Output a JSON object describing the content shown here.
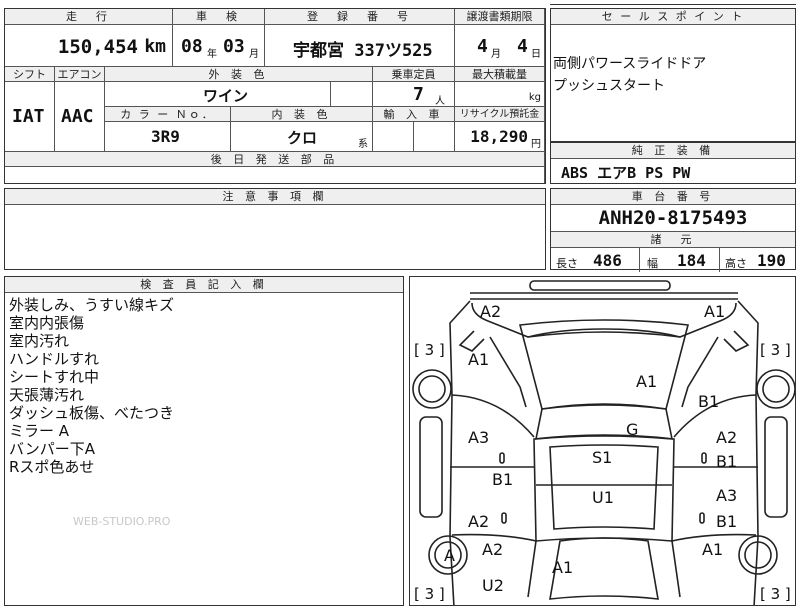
{
  "headers": {
    "mileage": "走　行",
    "inspection": "車　検",
    "registration": "登　録　番　号",
    "transfer_deadline": "譲渡書類期限",
    "sales_point": "セ ー ル ス ポ イ ン ト",
    "shift": "シフト",
    "aircon": "エアコン",
    "exterior_color": "外 装 色",
    "capacity": "乗車定員",
    "max_load": "最大積載量",
    "color_no": "カ ラ ー Ｎｏ．",
    "interior_color": "内 装 色",
    "import": "輸 入 車",
    "recycle": "リサイクル預託金",
    "later_parts": "後 日 発 送 部 品",
    "standard_equipment": "純 正 装 備",
    "notes": "注 意 事 項 欄",
    "chassis": "車 台 番 号",
    "specs": "諸　元",
    "inspector_notes": "検 査 員 記 入 欄"
  },
  "vehicle": {
    "mileage": "150,454",
    "mileage_unit": "km",
    "inspection_year": "08",
    "year_unit": "年",
    "inspection_month": "03",
    "month_unit": "月",
    "plate": "宇都宮 337ツ525",
    "deadline_month": "4",
    "deadline_month_unit": "月",
    "deadline_day": "4",
    "deadline_day_unit": "日",
    "shift": "IAT",
    "aircon": "AAC",
    "exterior_color": "ワイン",
    "capacity": "7",
    "capacity_unit": "人",
    "max_load_unit": "kg",
    "color_no": "3R9",
    "interior_color": "クロ",
    "interior_suffix": "系",
    "recycle_fee": "18,290",
    "recycle_unit": "円",
    "standard_equipment": "ABS エアB PS PW",
    "chassis_number": "ANH20-8175493",
    "length_label": "長さ",
    "length": "486",
    "width_label": "幅",
    "width": "184",
    "height_label": "高さ",
    "height": "190"
  },
  "sales_points": [
    "両側パワースライドドア",
    "プッシュスタート"
  ],
  "inspector_notes": [
    "外装しみ、うすい線キズ",
    "室内内張傷",
    "室内汚れ",
    "ハンドルすれ",
    "シートすれ中",
    "天張薄汚れ",
    "ダッシュ板傷、べたつき",
    "ミラー A",
    "バンパー下A",
    "Rスポ色あせ"
  ],
  "watermark": "WEB-STUDIO.PRO",
  "diagram": {
    "tire_left_front": "[ 3 ]",
    "tire_right_front": "[ 3 ]",
    "tire_left_rear": "[ 3 ]",
    "tire_right_rear": "[ 3 ]",
    "marks": [
      "A2",
      "A1",
      "A1",
      "A1",
      "B1",
      "G",
      "A3",
      "A2",
      "B1",
      "S1",
      "B1",
      "U1",
      "A2",
      "A3",
      "B1",
      "A",
      "A2",
      "A1",
      "A1",
      "U2"
    ]
  }
}
